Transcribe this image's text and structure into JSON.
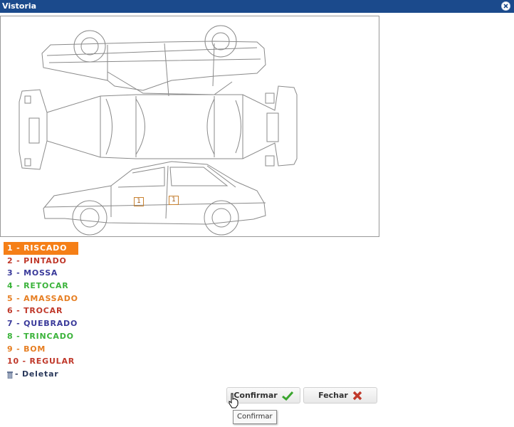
{
  "window": {
    "title": "Vistoria"
  },
  "legend": [
    {
      "label": "1 - RISCADO",
      "color": "#ffffff"
    },
    {
      "label": "2 - PINTADO",
      "color": "#c0392b"
    },
    {
      "label": "3 - MOSSA",
      "color": "#3a3a9a"
    },
    {
      "label": "4 - RETOCAR",
      "color": "#3bb33b"
    },
    {
      "label": "5 - AMASSADO",
      "color": "#e67e22"
    },
    {
      "label": "6 - TROCAR",
      "color": "#c0392b"
    },
    {
      "label": "7 - QUEBRADO",
      "color": "#3a3a9a"
    },
    {
      "label": "8 - TRINCADO",
      "color": "#3bb33b"
    },
    {
      "label": "9 - BOM",
      "color": "#e67e22"
    },
    {
      "label": "10 - REGULAR",
      "color": "#c0392b"
    }
  ],
  "delete_label": "- Deletar",
  "markers": [
    {
      "value": "1"
    },
    {
      "value": "1"
    }
  ],
  "buttons": {
    "confirm": "Confirmar",
    "close": "Fechar"
  },
  "tooltip": "Confirmar",
  "colors": {
    "titlebar": "#1b4a8c",
    "selected": "#f57f17",
    "confirm_icon": "#3aa52e",
    "close_icon": "#c0392b"
  },
  "icons": {
    "close": "close-circle-icon",
    "confirm": "checkmark-icon",
    "fechar": "red-x-icon",
    "delete": "trash-icon",
    "cursor": "hand-pointer-icon"
  }
}
